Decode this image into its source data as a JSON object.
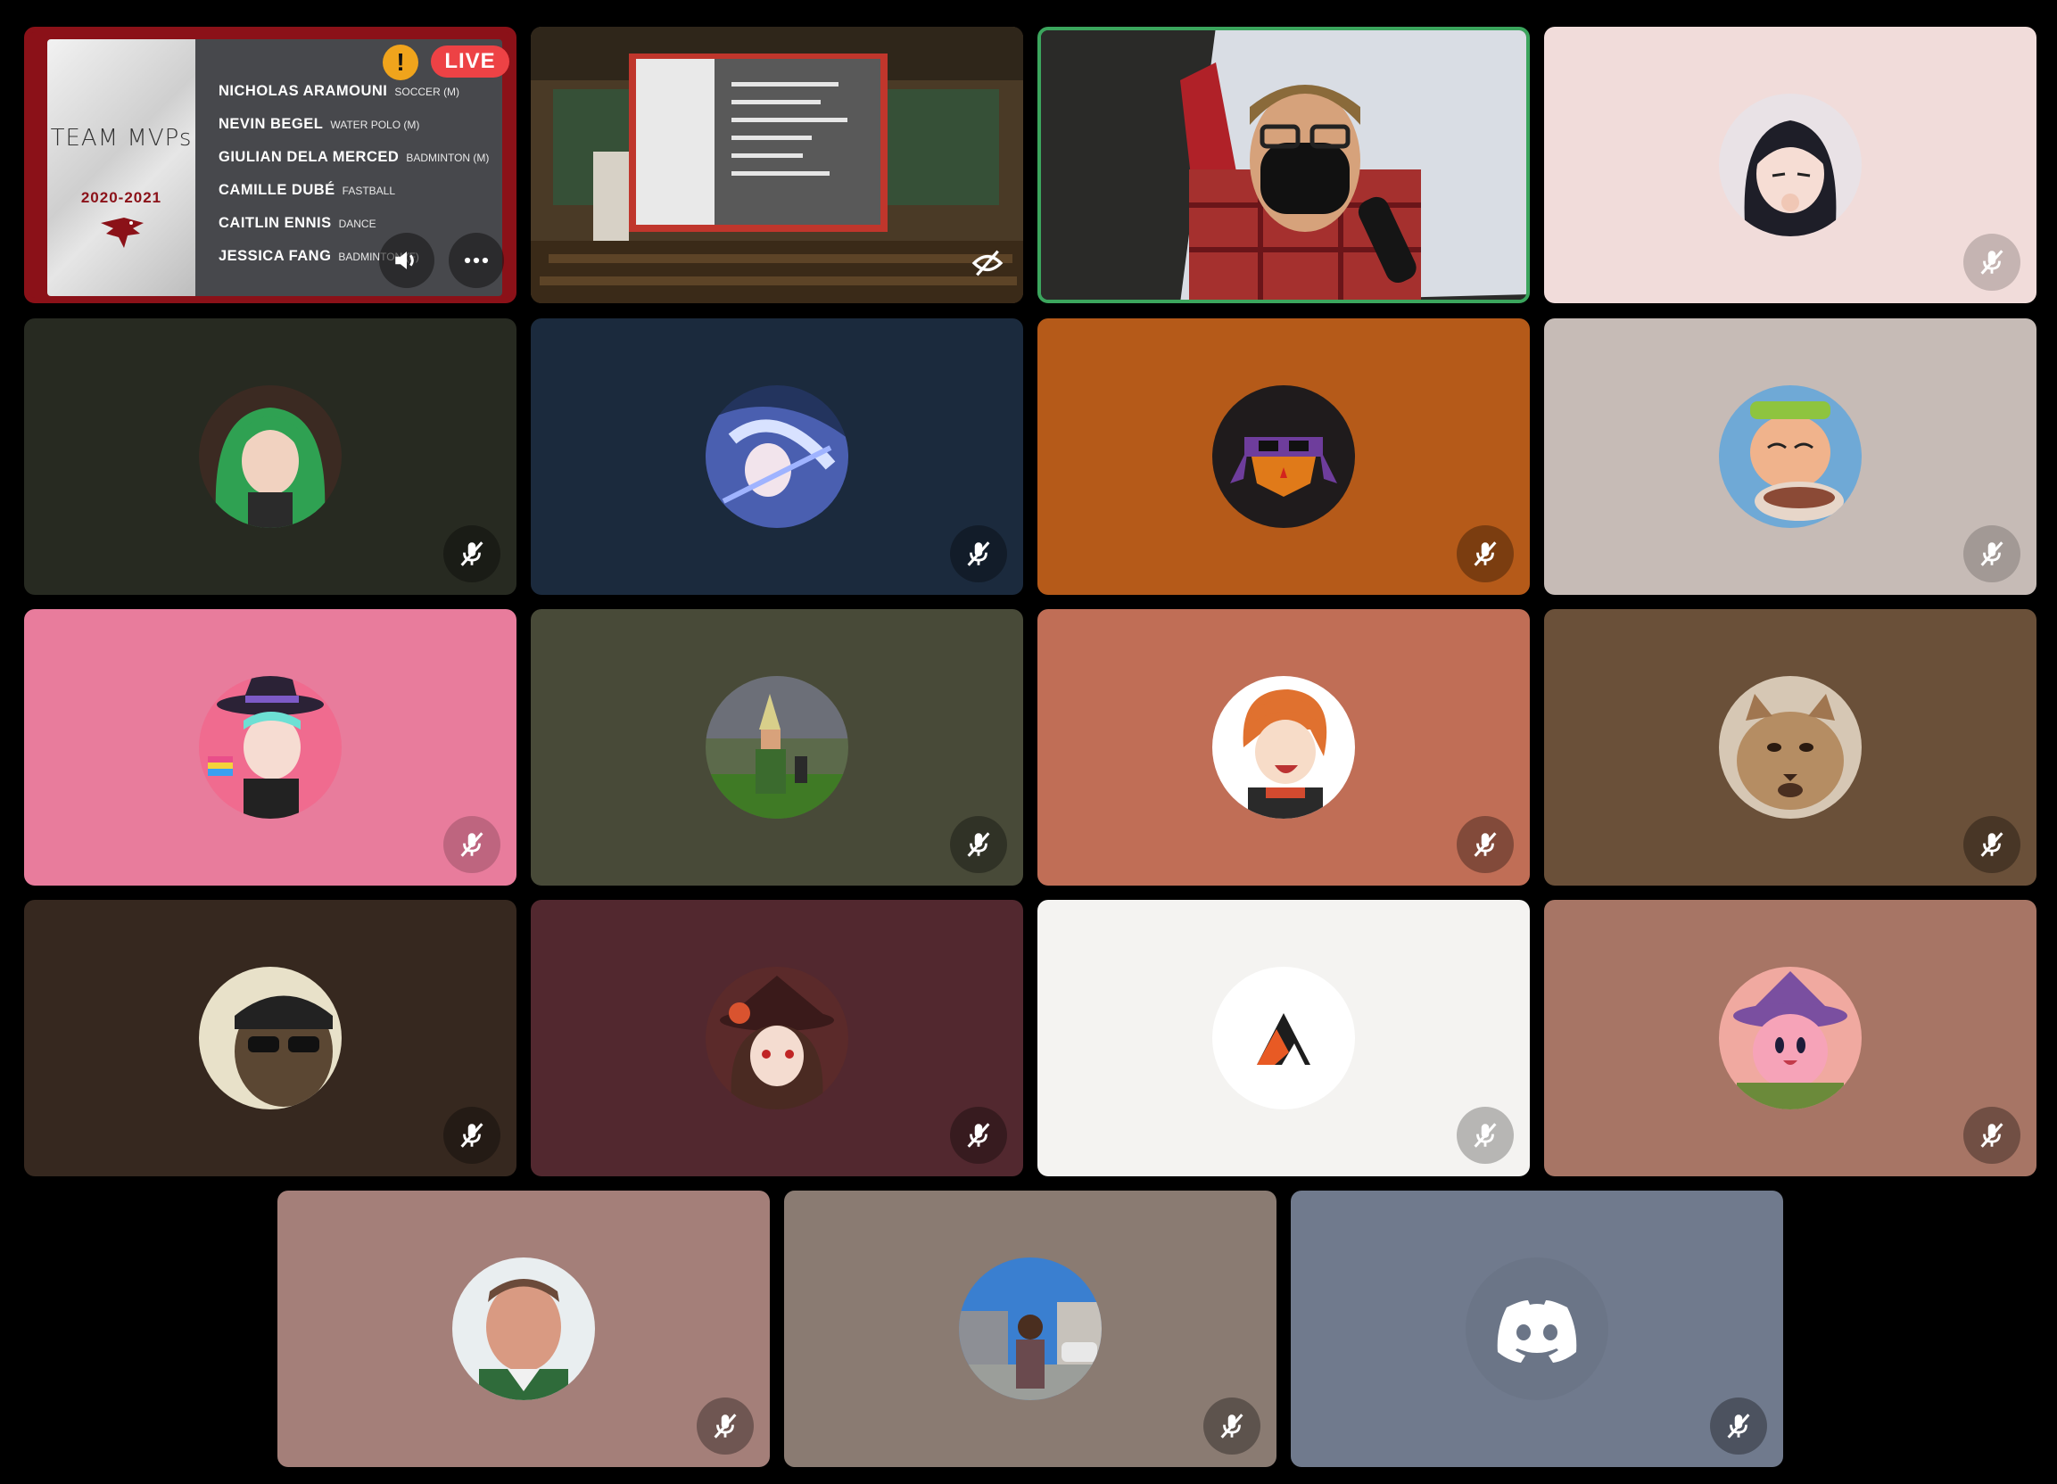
{
  "stream_tile": {
    "slide_title": "TEAM MVPs",
    "slide_years": "2020-2021",
    "live_badge": "LIVE",
    "warning_symbol": "!",
    "mvps": [
      {
        "name": "NICHOLAS ARAMOUNI",
        "sport": "SOCCER (M)"
      },
      {
        "name": "NEVIN BEGEL",
        "sport": "WATER POLO (M)"
      },
      {
        "name": "GIULIAN DELA MERCED",
        "sport": "BADMINTON (M)"
      },
      {
        "name": "CAMILLE DUBÉ",
        "sport": "FASTBALL"
      },
      {
        "name": "CAITLIN ENNIS",
        "sport": "DANCE"
      },
      {
        "name": "JESSICA FANG",
        "sport": "BADMINTON (F)"
      }
    ],
    "controls": [
      "volume-icon",
      "more-icon"
    ]
  },
  "room_stream_tile": {
    "icon": "hide-video-icon"
  },
  "camera_tile": {
    "speaking_color": "#3ba55d"
  },
  "participant_tiles": [
    {
      "bg": "#f1dcda",
      "avatar": "anime-girl-avatar",
      "muted": true
    },
    {
      "bg": "#272a21",
      "avatar": "green-hair-anime-avatar",
      "muted": true
    },
    {
      "bg": "#1b2a3d",
      "avatar": "blue-anime-avatar",
      "muted": true
    },
    {
      "bg": "#b55a19",
      "avatar": "ninja-turtle-avatar",
      "muted": true
    },
    {
      "bg": "#c6bbb6",
      "avatar": "cartoon-eating-avatar",
      "muted": true
    },
    {
      "bg": "#e87c9c",
      "avatar": "witch-hat-avatar",
      "muted": true
    },
    {
      "bg": "#484a38",
      "avatar": "game-character-avatar",
      "muted": true
    },
    {
      "bg": "#c06e56",
      "avatar": "orange-hair-anime-avatar",
      "muted": true
    },
    {
      "bg": "#6a5039",
      "avatar": "cat-avatar",
      "muted": true
    },
    {
      "bg": "#36281f",
      "avatar": "person-sunglasses-avatar",
      "muted": true
    },
    {
      "bg": "#52282f",
      "avatar": "hu-tao-avatar",
      "muted": true
    },
    {
      "bg": "#f4f3f1",
      "avatar": "triangle-logo-avatar",
      "muted": true
    },
    {
      "bg": "#a77565",
      "avatar": "kirby-avatar",
      "muted": true
    },
    {
      "bg": "#a47f79",
      "avatar": "man-portrait-avatar",
      "muted": true
    },
    {
      "bg": "#8a7b72",
      "avatar": "street-photo-avatar",
      "muted": true
    },
    {
      "bg": "#707a8d",
      "avatar": "discord-default-avatar",
      "muted": true
    }
  ]
}
